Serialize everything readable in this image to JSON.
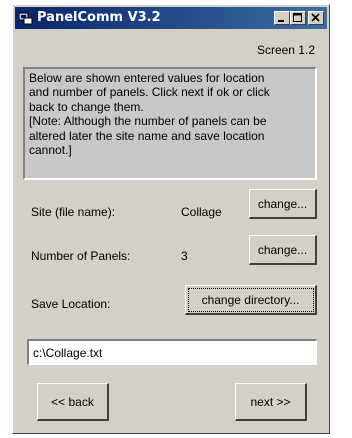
{
  "window": {
    "title": "PanelComm V3.2"
  },
  "screen_label": "Screen 1.2",
  "info_lines": [
    "Below are shown entered values for location",
    "and number of  panels. Click next if ok or click",
    "back to change them.",
    "[Note: Although the number of panels can be",
    "altered later the site name and save location",
    "cannot.]"
  ],
  "site": {
    "label": "Site (file name):",
    "value": "Collage",
    "button": "change..."
  },
  "panels": {
    "label": "Number of Panels:",
    "value": "3",
    "button": "change..."
  },
  "save_location": {
    "label": "Save Location:",
    "button": "change directory...",
    "path": "c:\\Collage.txt"
  },
  "nav": {
    "back": "<< back",
    "next": "next >>"
  },
  "colors": {
    "title_start": "#0a246a",
    "title_end": "#3a6ea5",
    "face": "#d4d0c8"
  },
  "icons": [
    "app-icon",
    "minimize-icon",
    "maximize-icon",
    "close-icon"
  ]
}
